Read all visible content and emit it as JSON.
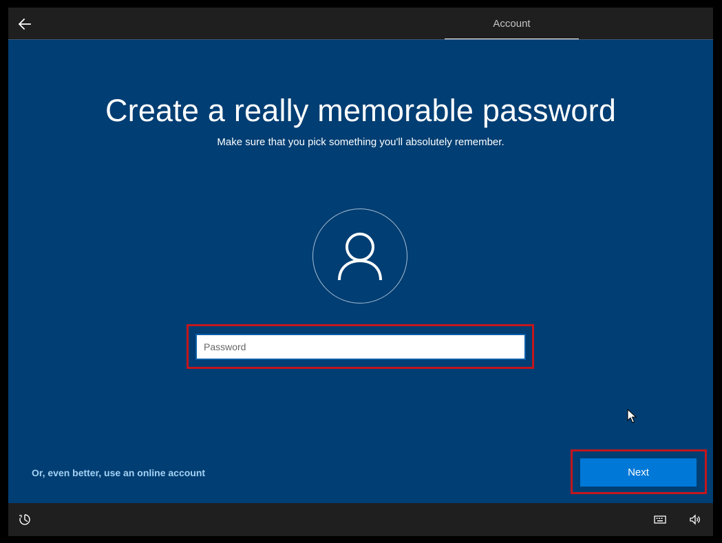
{
  "header": {
    "back_icon": "back-arrow-icon",
    "tab_label": "Account"
  },
  "main": {
    "title": "Create a really memorable password",
    "subtitle": "Make sure that you pick something you'll absolutely remember.",
    "avatar_icon": "user-icon",
    "password": {
      "value": "",
      "placeholder": "Password"
    },
    "online_account_link": "Or, even better, use an online account",
    "next_label": "Next"
  },
  "footer": {
    "ease_of_access_icon": "ease-of-access-icon",
    "keyboard_icon": "keyboard-icon",
    "volume_icon": "volume-icon"
  },
  "colors": {
    "background": "#003e73",
    "bar": "#1f1f1f",
    "accent": "#0078d7",
    "highlight": "#c4161c",
    "link": "#a5d2f5"
  }
}
